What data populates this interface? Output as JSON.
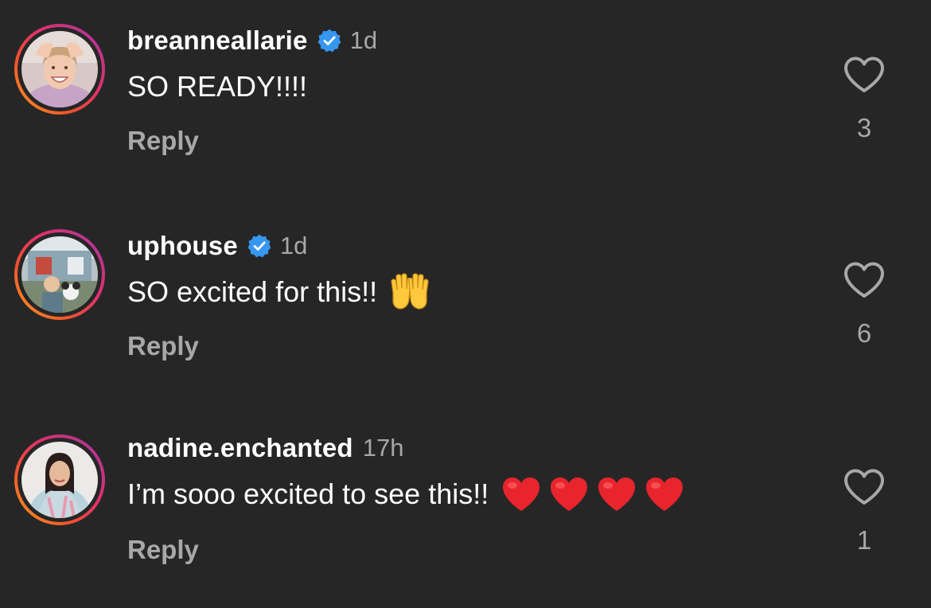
{
  "colors": {
    "background": "#262626",
    "secondary_text": "#a8a8a8",
    "verified_blue": "#3797f0",
    "heart_red": "#e8242d"
  },
  "comments": [
    {
      "username": "breanneallarie",
      "verified": true,
      "time": "1d",
      "text": "SO READY!!!!",
      "emoji": [],
      "reply_label": "Reply",
      "like_count": "3",
      "icon": "heart-outline-icon"
    },
    {
      "username": "uphouse",
      "verified": true,
      "time": "1d",
      "text": "SO excited for this!!",
      "emoji": [
        "raising-hands-emoji"
      ],
      "reply_label": "Reply",
      "like_count": "6",
      "icon": "heart-outline-icon"
    },
    {
      "username": "nadine.enchanted",
      "verified": false,
      "time": "17h",
      "text": "I’m sooo excited to see this!!",
      "emoji": [
        "red-heart-emoji",
        "red-heart-emoji",
        "red-heart-emoji",
        "red-heart-emoji"
      ],
      "reply_label": "Reply",
      "like_count": "1",
      "icon": "heart-outline-icon"
    }
  ]
}
